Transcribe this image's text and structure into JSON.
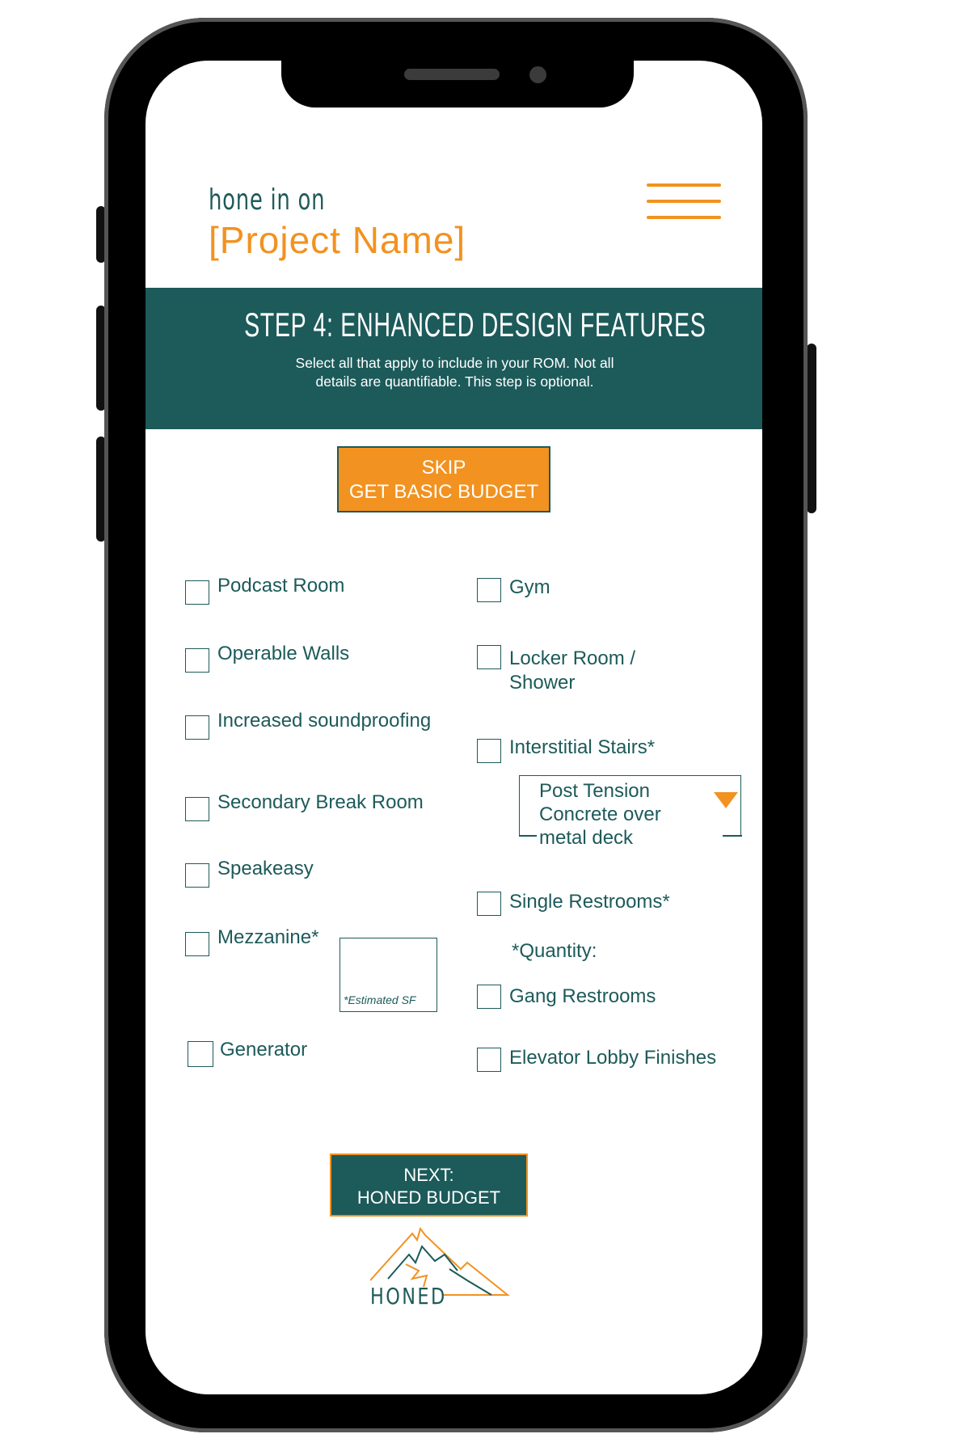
{
  "header": {
    "tagline": "hone in on",
    "project_name": "[Project Name]",
    "menu_icon": "hamburger-menu-icon"
  },
  "banner": {
    "title": "STEP 4: ENHANCED DESIGN FEATURES",
    "description": "Select all that apply to include in your ROM. Not all details are quantifiable. This step is optional."
  },
  "skip_button": {
    "line1": "SKIP",
    "line2": "GET BASIC BUDGET"
  },
  "left_options": [
    {
      "label": "Podcast Room"
    },
    {
      "label": "Operable Walls"
    },
    {
      "label": "Increased soundproofing"
    },
    {
      "label": "Secondary Break Room"
    },
    {
      "label": "Speakeasy"
    },
    {
      "label": "Mezzanine*"
    },
    {
      "label": "Generator"
    }
  ],
  "right_options": [
    {
      "label": "Gym"
    },
    {
      "label": "Locker Room / Shower"
    },
    {
      "label": "Interstitial Stairs*"
    },
    {
      "label": "Single Restrooms*"
    },
    {
      "label": "Gang Restrooms"
    },
    {
      "label": "Elevator Lobby Finishes"
    }
  ],
  "stairs_dropdown": {
    "selected": "Post Tension Concrete over metal deck"
  },
  "quantity_label": "*Quantity:",
  "mezzanine_sf_placeholder": "*Estimated SF",
  "next_button": {
    "line1": "NEXT:",
    "line2": "HONED BUDGET"
  },
  "logo": {
    "text": "HONED"
  },
  "colors": {
    "primary_teal": "#1d5a5a",
    "accent_orange": "#f29220"
  }
}
